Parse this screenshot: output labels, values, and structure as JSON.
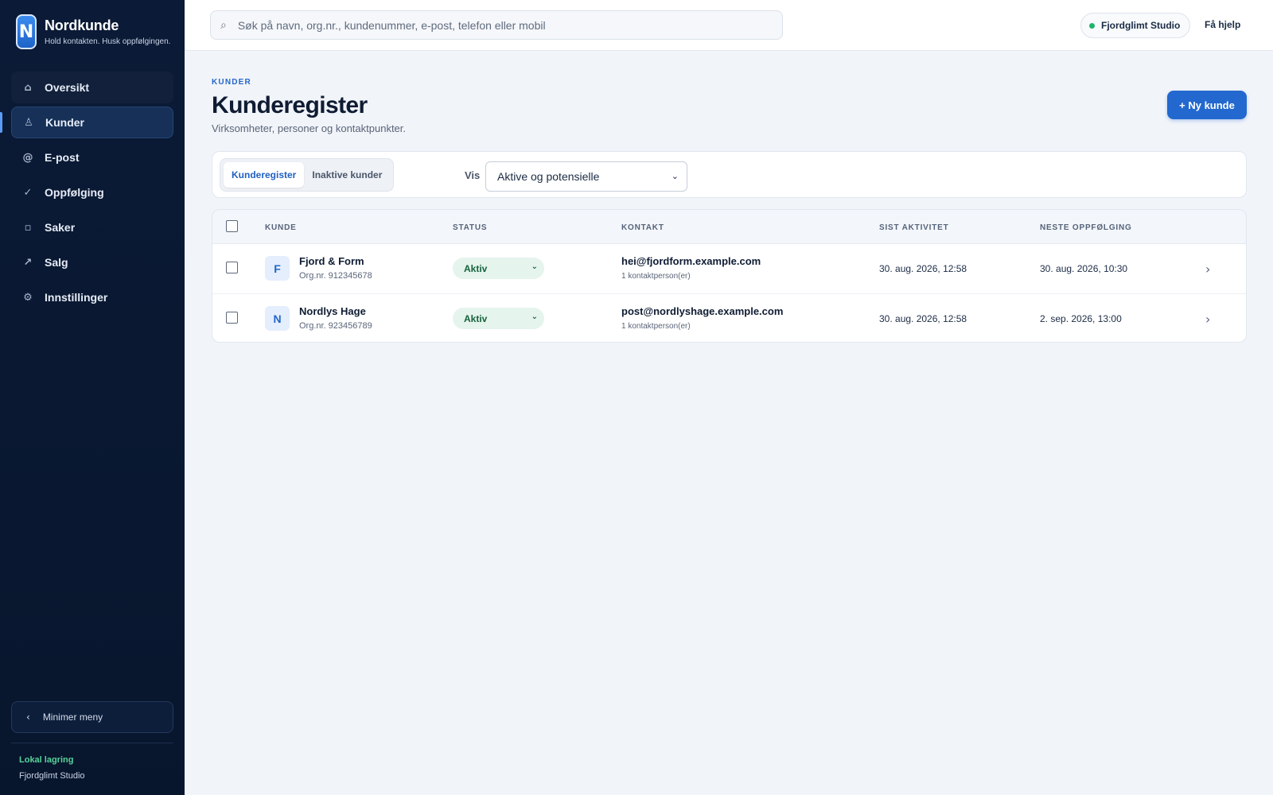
{
  "app": {
    "logo_letter": "N",
    "name": "Nordkunde",
    "tagline": "Hold kontakten. Husk oppfølgingen."
  },
  "sidebar": {
    "items": [
      {
        "label": "Oversikt",
        "icon": "home-icon",
        "glyph": "⌂"
      },
      {
        "label": "Kunder",
        "icon": "person-icon",
        "glyph": "♙"
      },
      {
        "label": "E-post",
        "icon": "at-icon",
        "glyph": "@"
      },
      {
        "label": "Oppfølging",
        "icon": "check-icon",
        "glyph": "✓"
      },
      {
        "label": "Saker",
        "icon": "folder-icon",
        "glyph": "▫"
      },
      {
        "label": "Salg",
        "icon": "trend-icon",
        "glyph": "↗"
      },
      {
        "label": "Innstillinger",
        "icon": "gear-icon",
        "glyph": "⚙"
      }
    ],
    "active_index": 1,
    "minimize_label": "Minimer meny",
    "storage_title": "Lokal lagring",
    "storage_org": "Fjordglimt Studio"
  },
  "topbar": {
    "search_placeholder": "Søk på navn, org.nr., kundenummer, e-post, telefon eller mobil",
    "org_name": "Fjordglimt Studio",
    "help_label": "Få hjelp"
  },
  "header": {
    "eyebrow": "KUNDER",
    "title": "Kunderegister",
    "subtitle": "Virksomheter, personer og kontaktpunkter.",
    "new_button": "+ Ny kunde"
  },
  "filters": {
    "tabs": [
      "Kunderegister",
      "Inaktive kunder"
    ],
    "active_tab": 0,
    "vis_label": "Vis",
    "vis_selected": "Aktive og potensielle"
  },
  "table": {
    "columns": [
      "KUNDE",
      "STATUS",
      "KONTAKT",
      "SIST AKTIVITET",
      "NESTE OPPFØLGING"
    ],
    "rows": [
      {
        "initial": "F",
        "name": "Fjord & Form",
        "org": "Org.nr. 912345678",
        "status": "Aktiv",
        "email": "hei@fjordform.example.com",
        "contacts": "1 kontaktperson(er)",
        "last_activity": "30. aug. 2026, 12:58",
        "next_followup": "30. aug. 2026, 10:30"
      },
      {
        "initial": "N",
        "name": "Nordlys Hage",
        "org": "Org.nr. 923456789",
        "status": "Aktiv",
        "email": "post@nordlyshage.example.com",
        "contacts": "1 kontaktperson(er)",
        "last_activity": "30. aug. 2026, 12:58",
        "next_followup": "2. sep. 2026, 13:00"
      }
    ]
  },
  "colors": {
    "sidebar_bg": "#0b1a36",
    "accent": "#2268cf",
    "status_active_bg": "#e5f4ec",
    "status_active_text": "#17633e",
    "storage_ok": "#57d39a"
  }
}
